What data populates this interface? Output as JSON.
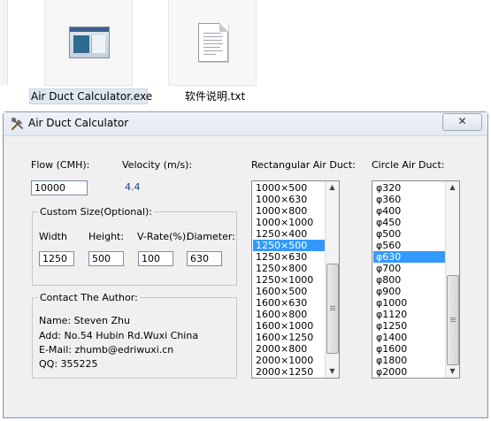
{
  "desktop": {
    "files": [
      {
        "name": "Air Duct Calculator.exe",
        "icon": "exe-window-icon"
      },
      {
        "name": "软件说明.txt",
        "icon": "text-file-icon"
      }
    ]
  },
  "window": {
    "title": "Air Duct Calculator",
    "close_label": "✕"
  },
  "flow": {
    "label": "Flow (CMH):",
    "value": "10000"
  },
  "velocity": {
    "label": "Velocity (m/s):",
    "value": "4.4"
  },
  "custom": {
    "legend": "Custom Size(Optional):",
    "width_label": "Width",
    "height_label": "Height:",
    "vrate_label": "V-Rate(%):",
    "diameter_label": "Diameter:",
    "width_value": "1250",
    "height_value": "500",
    "vrate_value": "100",
    "diameter_value": "630"
  },
  "contact": {
    "legend": "Contact The Author:",
    "name": "Name: Steven Zhu",
    "address": "Add: No.54 Hubin Rd.Wuxi China",
    "email": "E-Mail: zhumb@edriwuxi.cn",
    "qq": "QQ: 355225"
  },
  "rect_list": {
    "label": "Rectangular Air Duct:",
    "items": [
      "1000×500",
      "1000×630",
      "1000×800",
      "1000×1000",
      "1250×400",
      "1250×500",
      "1250×630",
      "1250×800",
      "1250×1000",
      "1600×500",
      "1600×630",
      "1600×800",
      "1600×1000",
      "1600×1250",
      "2000×800",
      "2000×1000",
      "2000×1250"
    ],
    "selected": "1250×500",
    "scroll_position": 0.86
  },
  "circle_list": {
    "label": "Circle Air Duct:",
    "items": [
      "φ320",
      "φ360",
      "φ400",
      "φ450",
      "φ500",
      "φ560",
      "φ630",
      "φ700",
      "φ800",
      "φ900",
      "φ1000",
      "φ1120",
      "φ1250",
      "φ1400",
      "φ1600",
      "φ1800",
      "φ2000"
    ],
    "selected": "φ630",
    "scroll_position": 1.0
  },
  "colors": {
    "selection": "#3399ff",
    "velocity_text": "#1b3f8f"
  }
}
